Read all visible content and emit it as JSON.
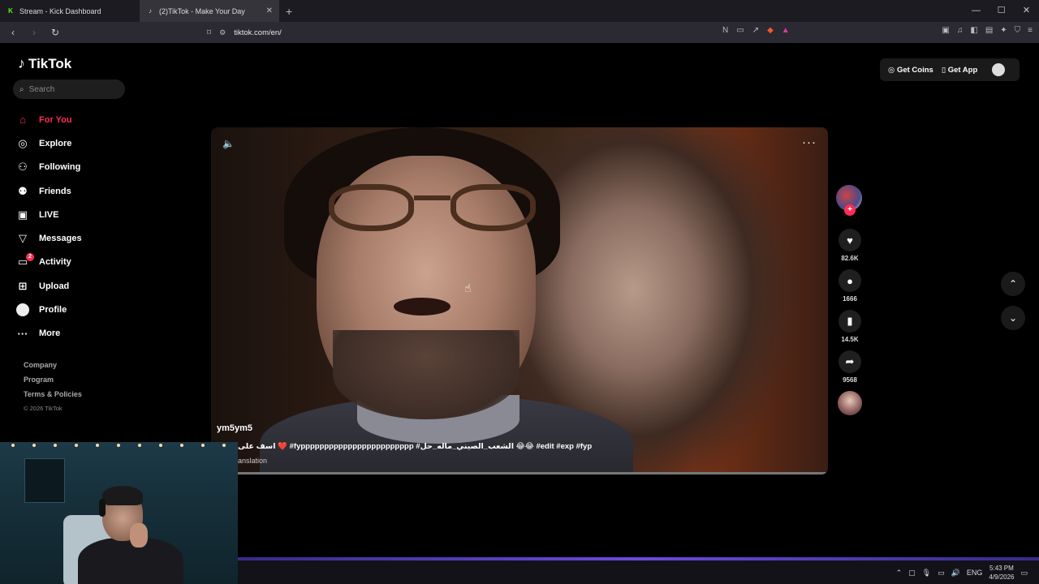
{
  "browser": {
    "tabs": [
      {
        "title": "Stream - Kick Dashboard",
        "favicon": "K",
        "favicon_color": "#53fc18",
        "active": false
      },
      {
        "title": "(2)TikTok - Make Your Day",
        "favicon": "♪",
        "favicon_color": "#ffffff",
        "active": true
      }
    ],
    "url": "tiktok.com/en/"
  },
  "tiktok": {
    "brand": "TikTok",
    "search_placeholder": "Search",
    "menu": [
      {
        "label": "For You",
        "icon": "home-icon",
        "active": true
      },
      {
        "label": "Explore",
        "icon": "compass-icon"
      },
      {
        "label": "Following",
        "icon": "following-icon"
      },
      {
        "label": "Friends",
        "icon": "friends-icon"
      },
      {
        "label": "LIVE",
        "icon": "live-icon"
      },
      {
        "label": "Messages",
        "icon": "messages-icon"
      },
      {
        "label": "Activity",
        "icon": "activity-icon",
        "badge": "2"
      },
      {
        "label": "Upload",
        "icon": "upload-icon"
      },
      {
        "label": "Profile",
        "icon": "avatar"
      },
      {
        "label": "More",
        "icon": "more-icon"
      }
    ],
    "footer": {
      "company": "Company",
      "program": "Program",
      "terms": "Terms & Policies",
      "copyright": "© 2026 TikTok"
    },
    "top_actions": {
      "get_coins": "Get Coins",
      "get_app": "Get App"
    },
    "video": {
      "author": "ym5ym5",
      "caption": "اسف على ❤️ #fypppppppppppppppppppppppp #الشعب_الصيني_ماله_حل 😂😂 #edit #exp #fyp",
      "translation": "anslation",
      "progress": 0.04
    },
    "actions": {
      "likes": "82.6K",
      "comments": "1666",
      "bookmarks": "14.5K",
      "shares": "9568"
    }
  },
  "taskbar": {
    "language": "ENG",
    "time": "5:43 PM",
    "date": "4/9/2026"
  },
  "colors": {
    "accent": "#fe2c55",
    "background": "#000000"
  }
}
